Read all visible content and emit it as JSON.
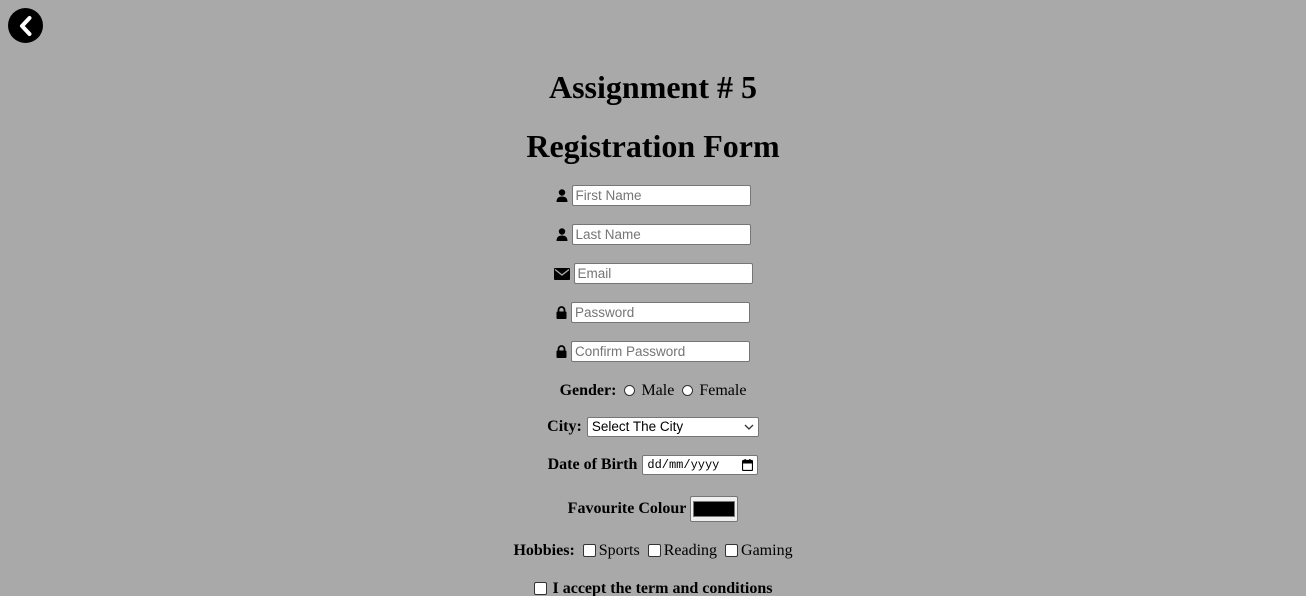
{
  "back_button": {
    "icon": "chevron-left-icon"
  },
  "headings": {
    "assignment": "Assignment # 5",
    "form_title": "Registration Form"
  },
  "fields": {
    "first_name": {
      "placeholder": "First Name",
      "value": "",
      "icon": "user-icon"
    },
    "last_name": {
      "placeholder": "Last Name",
      "value": "",
      "icon": "user-icon"
    },
    "email": {
      "placeholder": "Email",
      "value": "",
      "icon": "envelope-icon"
    },
    "password": {
      "placeholder": "Password",
      "value": "",
      "icon": "lock-icon"
    },
    "confirm_password": {
      "placeholder": "Confirm Password",
      "value": "",
      "icon": "lock-icon"
    }
  },
  "gender": {
    "label": "Gender:",
    "options": [
      "Male",
      "Female"
    ]
  },
  "city": {
    "label": "City:",
    "selected": "Select The City"
  },
  "dob": {
    "label": "Date of Birth",
    "value": "dd/mm/yyyy"
  },
  "favourite_colour": {
    "label": "Favourite Colour",
    "value": "#000000"
  },
  "hobbies": {
    "label": "Hobbies:",
    "options": [
      "Sports",
      "Reading",
      "Gaming"
    ]
  },
  "terms": {
    "label": "I accept the term and conditions"
  }
}
